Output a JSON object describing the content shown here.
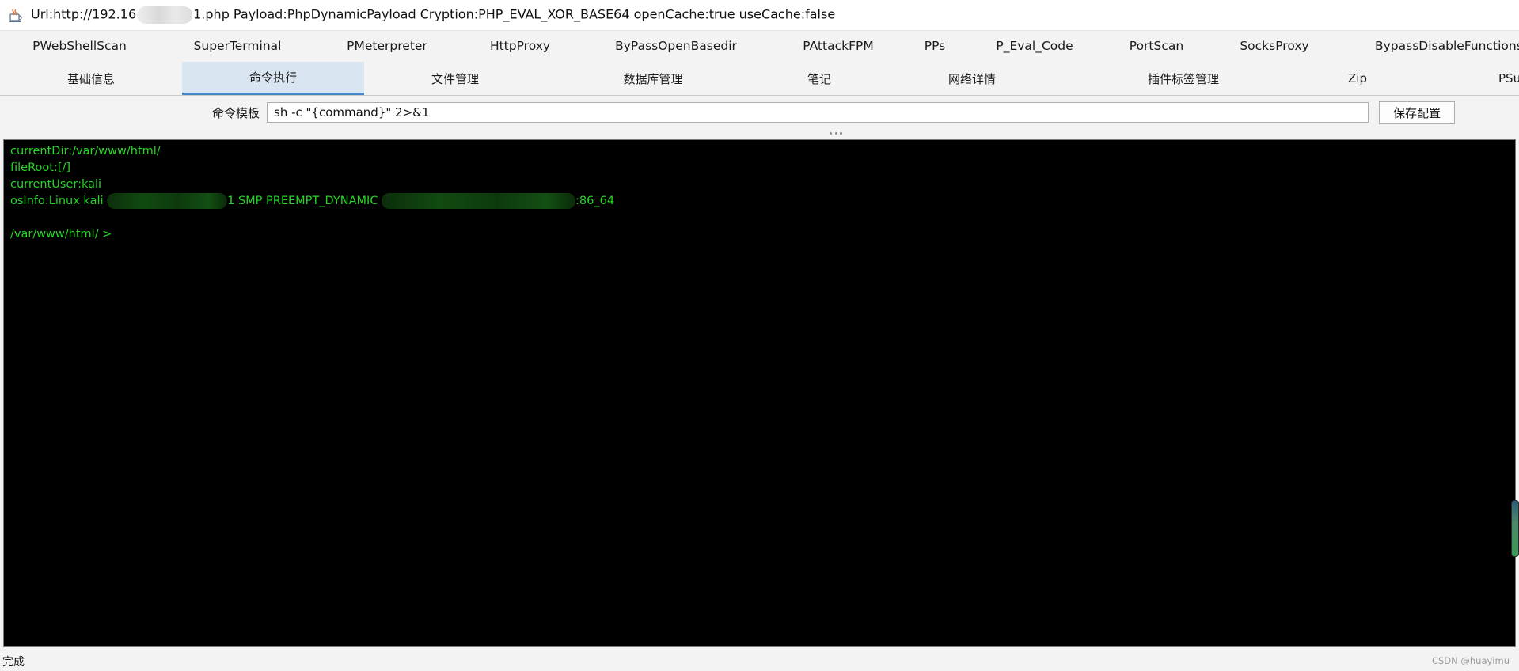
{
  "window": {
    "title_prefix": "Url:http://192.16",
    "title_suffix": "1.php Payload:PhpDynamicPayload Cryption:PHP_EVAL_XOR_BASE64 openCache:true useCache:false"
  },
  "plugin_tabs": [
    "PWebShellScan",
    "SuperTerminal",
    "PMeterpreter",
    "HttpProxy",
    "ByPassOpenBasedir",
    "PAttackFPM",
    "PPs",
    "P_Eval_Code",
    "PortScan",
    "SocksProxy",
    "BypassDisableFunctions"
  ],
  "main_tabs": [
    "基础信息",
    "命令执行",
    "文件管理",
    "数据库管理",
    "笔记",
    "网络详情",
    "插件标签管理",
    "Zip",
    "PSu"
  ],
  "active_main_tab": "命令执行",
  "command": {
    "template_label": "命令模板",
    "template_value": "sh -c \"{command}\" 2>&1",
    "save_label": "保存配置"
  },
  "terminal": {
    "line1": "currentDir:/var/www/html/",
    "line2": "fileRoot:[/]",
    "line3": "currentUser:kali",
    "os_prefix": "osInfo:Linux kali ",
    "os_middle": "1 SMP PREEMPT_DYNAMIC ",
    "os_suffix": ":86_64",
    "prompt": "/var/www/html/ >"
  },
  "status": {
    "text": "完成",
    "watermark": "CSDN @huayimu"
  },
  "colors": {
    "terminal_bg": "#000000",
    "terminal_fg": "#25d625",
    "active_tab_bg": "#d9e5f1",
    "active_tab_accent": "#4a86c6"
  }
}
